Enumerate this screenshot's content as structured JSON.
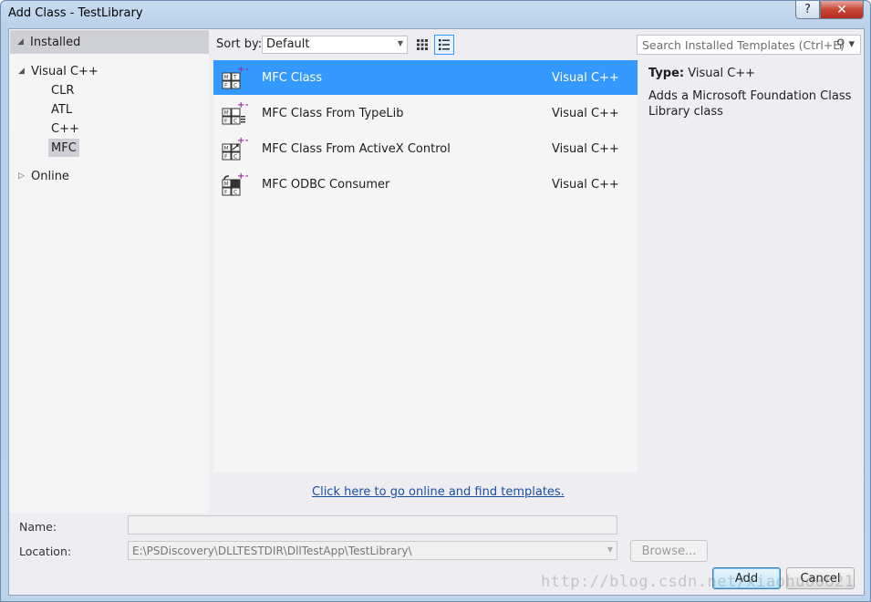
{
  "window": {
    "title": "Add Class - TestLibrary",
    "help_label": "?",
    "close_label": "✕"
  },
  "sidebar": {
    "installed_label": "Installed",
    "tree": [
      {
        "label": "Visual C++",
        "expander": "◢"
      },
      {
        "label": "CLR"
      },
      {
        "label": "ATL"
      },
      {
        "label": "C++"
      },
      {
        "label": "MFC",
        "selected": true
      },
      {
        "label": "Online",
        "expander": "▷"
      }
    ]
  },
  "toolbar": {
    "sort_label": "Sort by:",
    "sort_value": "Default",
    "search_placeholder": "Search Installed Templates (Ctrl+E)"
  },
  "templates": [
    {
      "name": "MFC Class",
      "language": "Visual C++",
      "selected": true,
      "icon": "mfc-class-icon"
    },
    {
      "name": "MFC Class From TypeLib",
      "language": "Visual C++",
      "icon": "mfc-typelib-icon"
    },
    {
      "name": "MFC Class From ActiveX Control",
      "language": "Visual C++",
      "icon": "mfc-activex-icon"
    },
    {
      "name": "MFC ODBC Consumer",
      "language": "Visual C++",
      "icon": "mfc-odbc-icon"
    }
  ],
  "detail": {
    "type_label": "Type:",
    "type_value": "Visual C++",
    "description": "Adds a Microsoft Foundation Class Library class"
  },
  "online_link": "Click here to go online and find templates.",
  "form": {
    "name_label": "Name:",
    "name_value": "",
    "location_label": "Location:",
    "location_value": "E:\\PSDiscovery\\DLLTESTDIR\\DllTestApp\\TestLibrary\\",
    "browse_label": "Browse...",
    "add_label": "Add",
    "cancel_label": "Cancel"
  },
  "watermark": "http://blog.csdn.net/xiaohuo0621",
  "colors": {
    "selection": "#3399ff",
    "link": "#1a4fa3",
    "close": "#c7463a"
  }
}
